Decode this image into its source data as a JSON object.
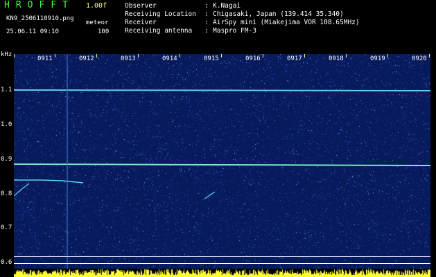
{
  "header": {
    "app_title": "HROFFT",
    "app_version": "1.00f",
    "file_name": "KN9_2506110910.png",
    "mode": "meteor",
    "timestamp": "25.06.11 09:10",
    "count": "100",
    "info": [
      {
        "label": "Observer",
        "value": "K.Nagai"
      },
      {
        "label": "Receiving Location",
        "value": "Chigasaki, Japan (139.414 35.340)"
      },
      {
        "label": "Receiver",
        "value": "AirSpy mini (Miakejima VOR 108.65MHz)"
      },
      {
        "label": "Receiving antenna",
        "value": "Maspro FM-3"
      }
    ],
    "separator": ":"
  },
  "axis": {
    "unit": "kHz",
    "y_labels": [
      "1.1",
      "1.0",
      "0.9",
      "0.8",
      "0.7",
      "0.6"
    ],
    "time_labels": [
      "0911",
      "0912",
      "0913",
      "0914",
      "0915",
      "0916",
      "0917",
      "0918",
      "0919",
      "0920"
    ]
  },
  "colors": {
    "background": "#071a5c",
    "signal": "#6ee6e6",
    "title": "#3cff3c",
    "version": "#ffff66",
    "level": "#ffff33"
  }
}
